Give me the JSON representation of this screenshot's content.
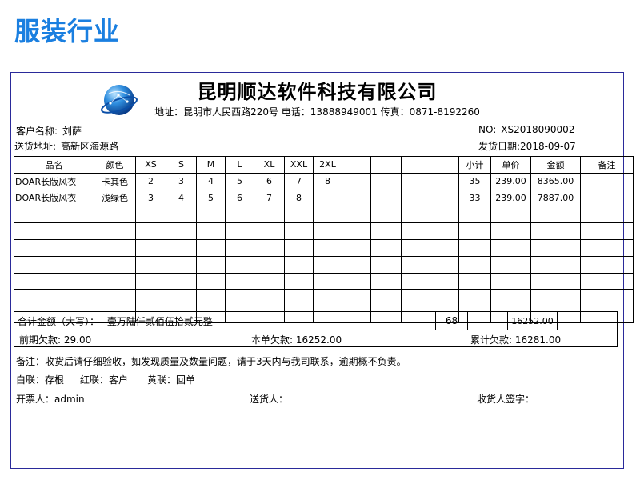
{
  "page_title": "服装行业",
  "company": {
    "name": "昆明顺达软件科技有限公司",
    "contact": "地址：昆明市人民西路220号 电话：13888949001 传真：0871-8192260"
  },
  "customer": {
    "label": "客户名称:",
    "value": "刘萨"
  },
  "invoice_no": {
    "label": "NO:",
    "value": "XS2018090002"
  },
  "address": {
    "label": "送货地址:",
    "value": "高新区海源路"
  },
  "ship_date": {
    "label": "发货日期:",
    "value": "2018-09-07"
  },
  "table": {
    "headers": [
      "品名",
      "颜色",
      "XS",
      "S",
      "M",
      "L",
      "XL",
      "XXL",
      "2XL",
      "",
      "",
      "",
      "",
      "小计",
      "单价",
      "金额",
      "备注"
    ],
    "rows": [
      [
        "DOAR长版风衣",
        "卡其色",
        "2",
        "3",
        "4",
        "5",
        "6",
        "7",
        "8",
        "",
        "",
        "",
        "",
        "35",
        "239.00",
        "8365.00",
        ""
      ],
      [
        "DOAR长版风衣",
        "浅绿色",
        "3",
        "4",
        "5",
        "6",
        "7",
        "8",
        "",
        "",
        "",
        "",
        "",
        "33",
        "239.00",
        "7887.00",
        ""
      ]
    ]
  },
  "totals": {
    "amount_words_label": "合计金额（大写）：",
    "amount_words": "壹万陆仟贰佰伍拾贰元整",
    "total_qty": "68",
    "total_amount": "16252.00",
    "prev_debt": "前期欠款: 29.00",
    "this_debt": "本单欠款: 16252.00",
    "cum_debt": "累计欠款: 16281.00"
  },
  "notes": "备注：收货后请仔细验收，如发现质量及数量问题，请于3天内与我司联系，逾期概不负责。",
  "copies": {
    "white": "白联：存根",
    "red": "红联：客户",
    "yellow": "黄联：回单"
  },
  "signatures": {
    "issuer": "开票人：admin",
    "deliverer": "送货人：",
    "receiver": "收货人签字："
  },
  "colors": {
    "title": "#1a7fe0",
    "frame": "#2a2a9a"
  },
  "logo_icon": "globe-logo-icon"
}
